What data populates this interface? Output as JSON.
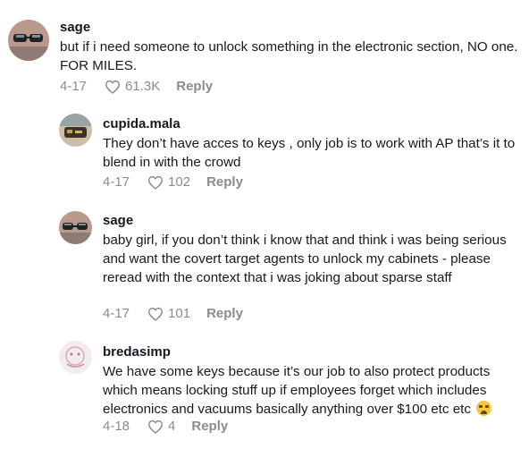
{
  "comments": [
    {
      "username": "sage",
      "text": "but if i need someone to unlock something in the electronic section, NO one. FOR MILES.",
      "date": "4-17",
      "likes": "61.3K",
      "reply": "Reply",
      "avatar_icon": "user-avatar-sunglasses"
    },
    {
      "username": "cupida.mala",
      "text": "They don’t have acces to keys , only job is to work with AP that’s it to blend in with the crowd",
      "date": "4-17",
      "likes": "102",
      "reply": "Reply",
      "avatar_icon": "user-avatar-photo"
    },
    {
      "username": "sage",
      "text": "baby girl, if you don’t think i know that and think i was being serious and want the covert target agents to unlock my cabinets - please reread with the context that i was joking about sparse staff",
      "date": "4-17",
      "likes": "101",
      "reply": "Reply",
      "avatar_icon": "user-avatar-sunglasses"
    },
    {
      "username": "bredasimp",
      "text": "We have some keys because it’s our job to also protect products which means locking stuff up if employees forget which includes electronics and vacuums basically anything over $100 etc etc",
      "emoji": "crying-face-emoji",
      "date": "4-18",
      "likes": "4",
      "reply": "Reply",
      "avatar_icon": "user-avatar-sketch"
    }
  ],
  "colors": {
    "text": "#161823",
    "meta": "#8a8b91"
  }
}
